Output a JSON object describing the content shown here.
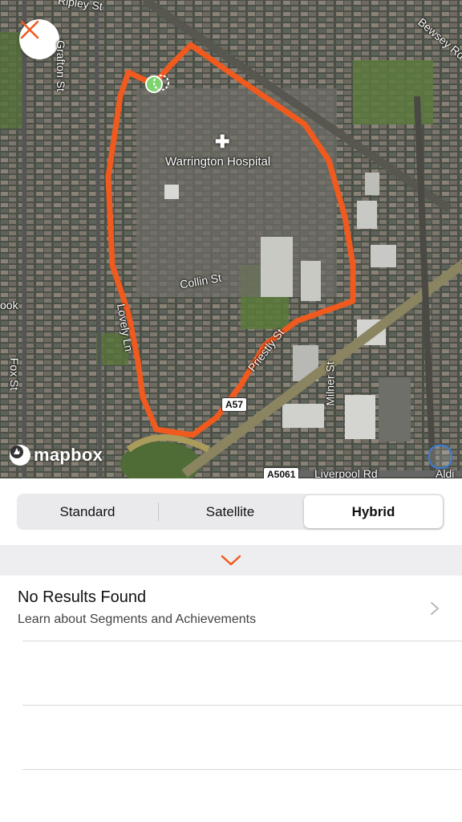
{
  "map": {
    "labels": {
      "ripley_st": "Ripley St",
      "grafton_st": "Grafton St",
      "bewsey_rd": "Bewsey Rd",
      "hospital": "Warrington Hospital",
      "collin_st": "Collin St",
      "lovely_ln": "Lovely Ln",
      "fox_st": "Fox St",
      "priestly_st": "Priestly St",
      "milner_st": "Milner St",
      "liverpool_rd": "Liverpool Rd",
      "aldi": "Aldi",
      "brook": "ook"
    },
    "shields": {
      "a57": "A57",
      "a5061": "A5061"
    },
    "attribution": "mapbox",
    "route_color": "#f05a1e",
    "start_marker_color": "#7ed36f"
  },
  "map_type_selector": {
    "options": [
      {
        "label": "Standard",
        "selected": false
      },
      {
        "label": "Satellite",
        "selected": false
      },
      {
        "label": "Hybrid",
        "selected": true
      }
    ]
  },
  "panel": {
    "collapse_icon": "chevron-down-icon",
    "accent_color": "#f05a1e"
  },
  "results": {
    "title": "No Results Found",
    "subtitle": "Learn about Segments and Achievements"
  },
  "icons": {
    "close": "close-icon",
    "disclosure": "chevron-right-icon",
    "hospital": "hospital-cross-icon",
    "shop": "shopping-cart-icon"
  }
}
